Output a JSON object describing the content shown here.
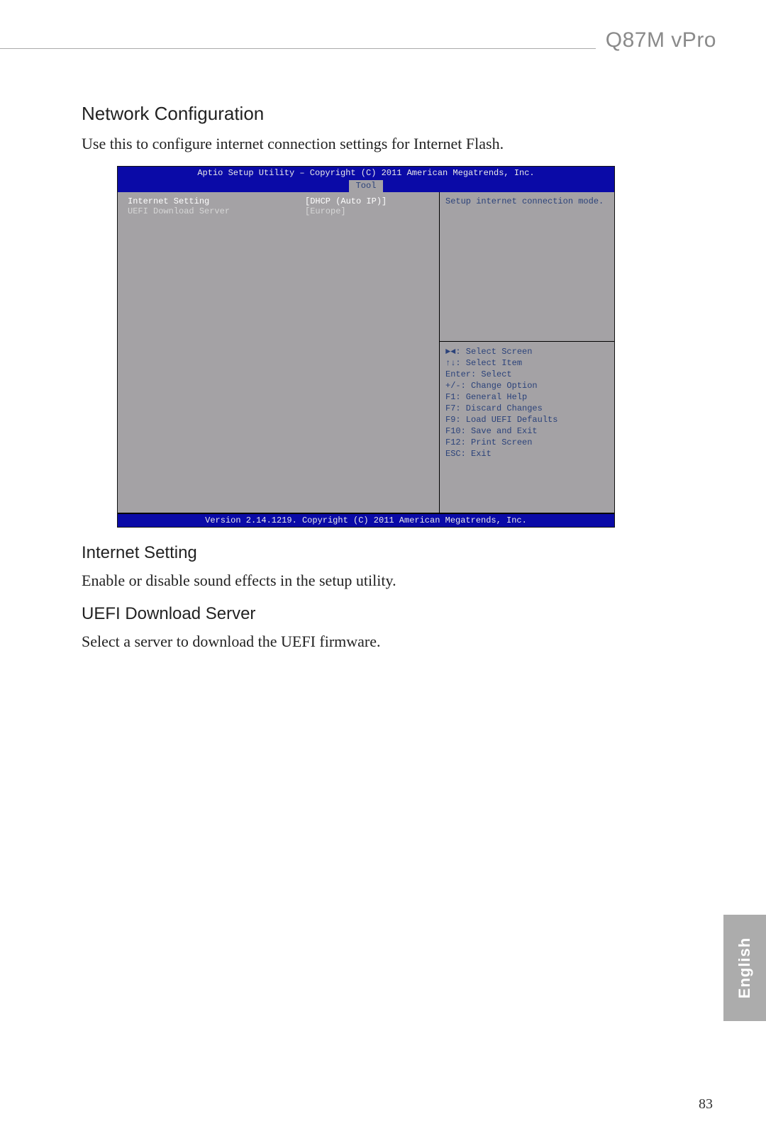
{
  "header": {
    "product": "Q87M vPro"
  },
  "section": {
    "title": "Network Configuration",
    "intro": "Use this to configure internet connection settings for Internet Flash."
  },
  "bios": {
    "top": "Aptio Setup Utility – Copyright (C) 2011 American Megatrends, Inc.",
    "tab": "Tool",
    "rows": {
      "r0": {
        "label": "Internet Setting",
        "value": "[DHCP (Auto IP)]"
      },
      "r1": {
        "label": "UEFI Download Server",
        "value": "[Europe]"
      }
    },
    "help": "Setup internet connection mode.",
    "nav": {
      "n0": "►◄: Select Screen",
      "n1": "↑↓: Select Item",
      "n2": "Enter: Select",
      "n3": "+/-: Change Option",
      "n4": "F1: General Help",
      "n5": "F7: Discard Changes",
      "n6": "F9: Load UEFI Defaults",
      "n7": "F10: Save and Exit",
      "n8": "F12: Print Screen",
      "n9": "ESC: Exit"
    },
    "bottom": "Version 2.14.1219. Copyright (C) 2011 American Megatrends, Inc."
  },
  "sub1": {
    "title": "Internet Setting",
    "body": "Enable or disable sound effects in the setup utility."
  },
  "sub2": {
    "title": "UEFI Download Server",
    "body": "Select a server to download the UEFI firmware."
  },
  "lang": "English",
  "page_number": "83"
}
